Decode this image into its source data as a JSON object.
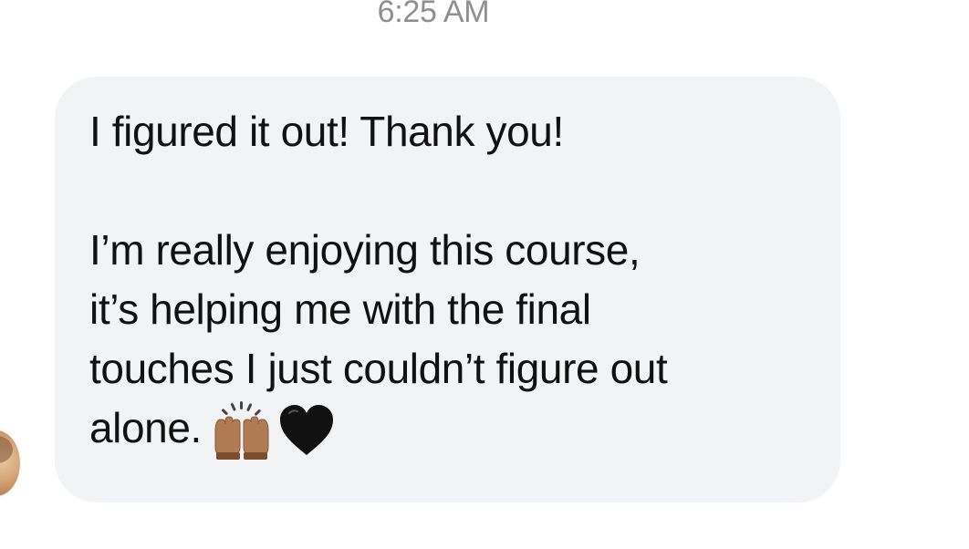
{
  "conversation": {
    "timestamp": "6:25 AM"
  },
  "message": {
    "line1": "I figured it out! Thank you!",
    "line2": "I’m really enjoying this course,",
    "line3": "it’s helping me with the final",
    "line4": "touches I just couldn’t figure out",
    "line5": "alone.",
    "emojis": [
      "raising-hands-icon",
      "black-heart-icon"
    ]
  },
  "colors": {
    "bubble_background": "#f2f3f5",
    "text": "#111111",
    "timestamp": "#8e8e93"
  }
}
